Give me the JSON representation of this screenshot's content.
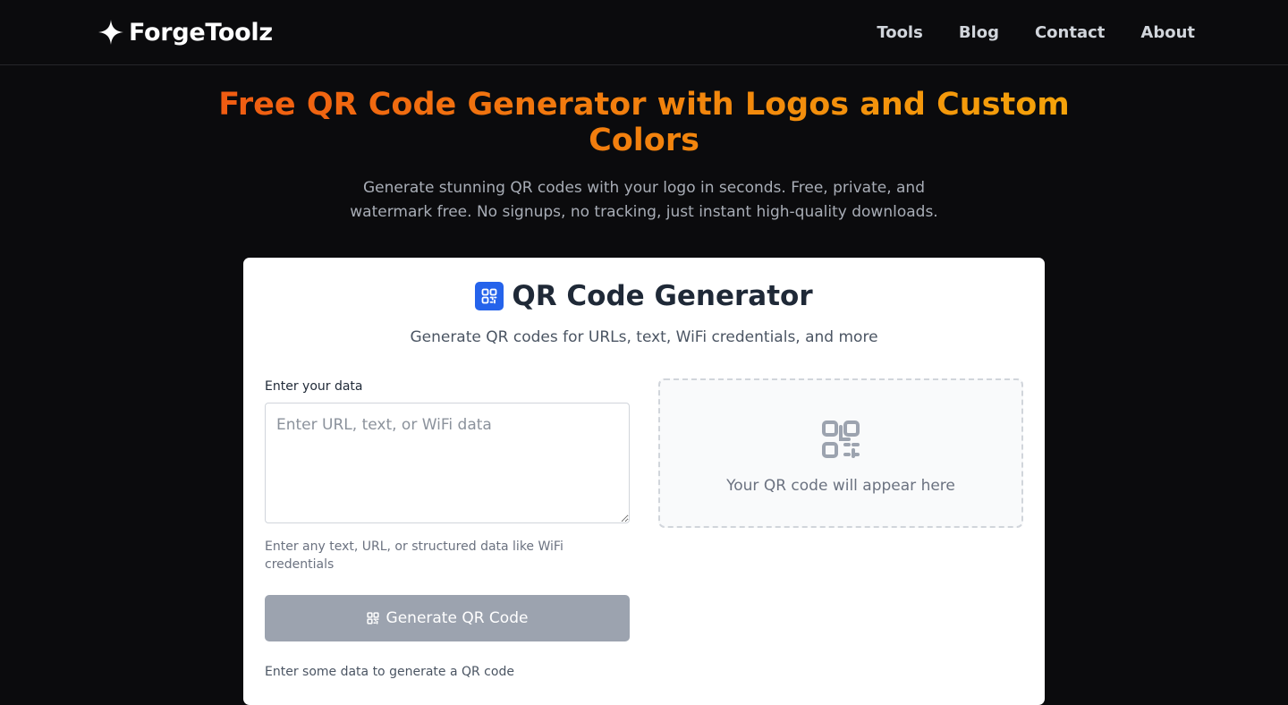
{
  "nav": {
    "brand": "ForgeToolz",
    "links": [
      {
        "label": "Tools"
      },
      {
        "label": "Blog"
      },
      {
        "label": "Contact"
      },
      {
        "label": "About"
      }
    ]
  },
  "hero": {
    "title": "Free QR Code Generator with Logos and Custom Colors",
    "subtitle": "Generate stunning QR codes with your logo in seconds. Free, private, and watermark free. No signups, no tracking, just instant high-quality downloads."
  },
  "tool": {
    "title": "QR Code Generator",
    "subtitle": "Generate QR codes for URLs, text, WiFi credentials, and more",
    "input_label": "Enter your data",
    "input_value": "",
    "input_placeholder": "Enter URL, text, or WiFi data",
    "helper_text": "Enter any text, URL, or structured data like WiFi credentials",
    "button_label": "Generate QR Code",
    "status_text": "Enter some data to generate a QR code",
    "preview_text": "Your QR code will appear here"
  },
  "colors": {
    "background": "#0b0b0d",
    "title_gradient_start": "#f05a12",
    "title_gradient_end": "#f5a40a",
    "accent_blue": "#2563eb",
    "button_disabled": "#9ca3af"
  },
  "icons": {
    "brand": "sparkle-icon",
    "title": "qr-code-icon",
    "button": "qr-code-icon",
    "preview": "qr-code-icon"
  }
}
